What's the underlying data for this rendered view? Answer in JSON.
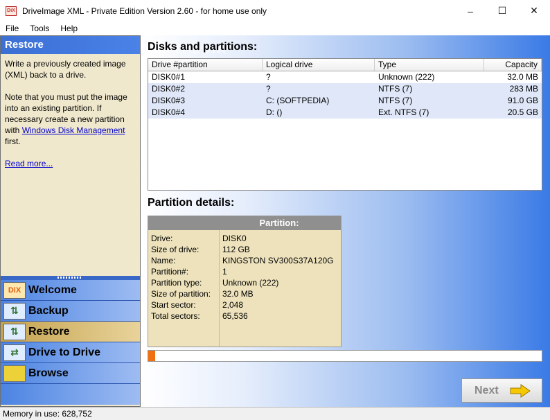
{
  "window": {
    "title": "DriveImage XML - Private Edition Version 2.60 - for home use only",
    "app_icon_text": "DiX",
    "minimize": "–",
    "maximize": "☐",
    "close": "✕"
  },
  "menu": [
    {
      "label": "File"
    },
    {
      "label": "Tools"
    },
    {
      "label": "Help"
    }
  ],
  "left": {
    "header": "Restore",
    "para1": "Write a previously created image (XML) back to a drive.",
    "para2_pre": "Note that you must put the image into an existing partition. If necessary create a new partition with ",
    "para2_link": "Windows Disk Management",
    "para2_post": " first.",
    "read_more": "Read more..."
  },
  "nav": [
    {
      "label": "Welcome",
      "icon": "DiX"
    },
    {
      "label": "Backup",
      "icon": "⇅"
    },
    {
      "label": "Restore",
      "icon": "⇅"
    },
    {
      "label": "Drive to Drive",
      "icon": "⇄"
    },
    {
      "label": "Browse",
      "icon": ""
    }
  ],
  "disks": {
    "title": "Disks and partitions:",
    "watermark": "SOFTPEDIA",
    "columns": [
      "Drive #partition",
      "Logical drive",
      "Type",
      "Capacity"
    ],
    "rows": [
      [
        "DISK0#1",
        "?",
        "Unknown (222)",
        "32.0 MB"
      ],
      [
        "DISK0#2",
        "?",
        "NTFS (7)",
        "283 MB"
      ],
      [
        "DISK0#3",
        "C: (SOFTPEDIA)",
        "NTFS (7)",
        "91.0 GB"
      ],
      [
        "DISK0#4",
        "D: ()",
        "Ext. NTFS (7)",
        "20.5 GB"
      ]
    ]
  },
  "details": {
    "title": "Partition details:",
    "head": "Partition:",
    "labels": [
      "Drive:",
      "Size of drive:",
      "Name:",
      "Partition#:",
      "Partition type:",
      "Size of partition:",
      "Start sector:",
      "Total sectors:"
    ],
    "values": [
      "DISK0",
      "112 GB",
      "KINGSTON SV300S37A120G",
      "1",
      "Unknown (222)",
      "32.0 MB",
      "2,048",
      "65,536"
    ]
  },
  "progress": {
    "fraction": 0.017
  },
  "next_button": {
    "label": "Next"
  },
  "status": {
    "text": "Memory in use: 628,752"
  },
  "colors": {
    "accent": "#3a7ae6",
    "progress": "#f07010",
    "panel": "#f0e8cc"
  }
}
